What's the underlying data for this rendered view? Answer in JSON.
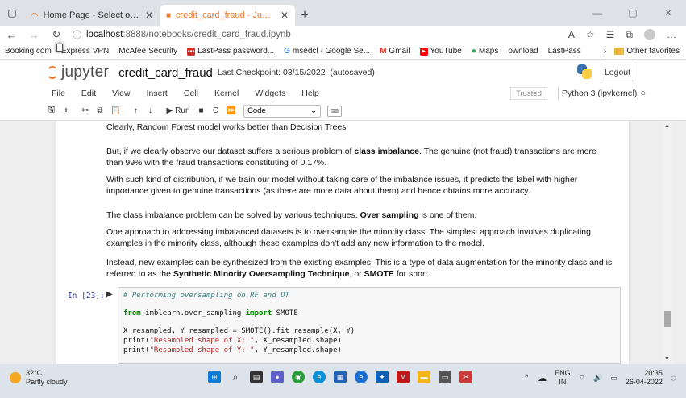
{
  "browser": {
    "tabs": [
      {
        "title": "Home Page - Select or create a n",
        "active": false
      },
      {
        "title": "credit_card_fraud - Jupyter Note",
        "active": true
      }
    ],
    "url_host": "localhost",
    "url_rest": ":8888/notebooks/credit_card_fraud.ipynb",
    "bookmarks": [
      "Booking.com",
      "Express VPN",
      "McAfee Security",
      "LastPass password...",
      "msedcl - Google Se...",
      "Gmail",
      "YouTube",
      "Maps",
      "ownload",
      "LastPass"
    ],
    "other_favorites": "Other favorites"
  },
  "jupyter": {
    "logo_text": "jupyter",
    "notebook_title": "credit_card_fraud",
    "checkpoint": "Last Checkpoint: 03/15/2022",
    "autosave": "(autosaved)",
    "logout_label": "Logout",
    "menu": [
      "File",
      "Edit",
      "View",
      "Insert",
      "Cell",
      "Kernel",
      "Widgets",
      "Help"
    ],
    "trusted_label": "Trusted",
    "kernel_label": "Python 3 (ipykernel)",
    "toolbar": {
      "run_label": "Run",
      "cell_type": "Code"
    }
  },
  "notebook": {
    "markdown": {
      "p1": "Clearly, Random Forest model works better than Decision Trees",
      "p2a": "But, if we clearly observe our dataset suffers a serious problem of ",
      "p2b": "class imbalance",
      "p2c": ". The genuine (not fraud) transactions are more than 99% with the fraud transactions constituting of 0.17%.",
      "p3": "With such kind of distribution, if we train our model without taking care of the imbalance issues, it predicts the label with higher importance given to genuine transactions (as there are more data about them) and hence obtains more accuracy.",
      "p4a": "The class imbalance problem can be solved by various techniques. ",
      "p4b": "Over sampling",
      "p4c": " is one of them.",
      "p5": "One approach to addressing imbalanced datasets is to oversample the minority class. The simplest approach involves duplicating examples in the minority class, although these examples don't add any new information to the model.",
      "p6a": "Instead, new examples can be synthesized from the existing examples. This is a type of data augmentation for the minority class and is referred to as the ",
      "p6b": "Synthetic Minority Oversampling Technique",
      "p6c": ", or ",
      "p6d": "SMOTE",
      "p6e": " for short."
    },
    "code_cell": {
      "prompt": "In [23]:",
      "line1_comment": "# Performing oversampling on RF and DT",
      "line2_kw1": "from",
      "line2_mid": " imblearn.over_sampling ",
      "line2_kw2": "import",
      "line2_end": " SMOTE",
      "line3": "X_resampled, Y_resampled = SMOTE().fit_resample(X, Y)",
      "line4_a": "print(",
      "line4_str": "\"Resampled shape of X: \"",
      "line4_b": ", X_resampled.shape)",
      "line5_a": "print(",
      "line5_str": "\"Resampled shape of Y: \"",
      "line5_b": ", Y_resampled.shape)"
    }
  },
  "taskbar": {
    "temperature": "32°C",
    "weather": "Partly cloudy",
    "lang1": "ENG",
    "lang2": "IN",
    "time": "20:35",
    "date": "26-04-2022"
  }
}
